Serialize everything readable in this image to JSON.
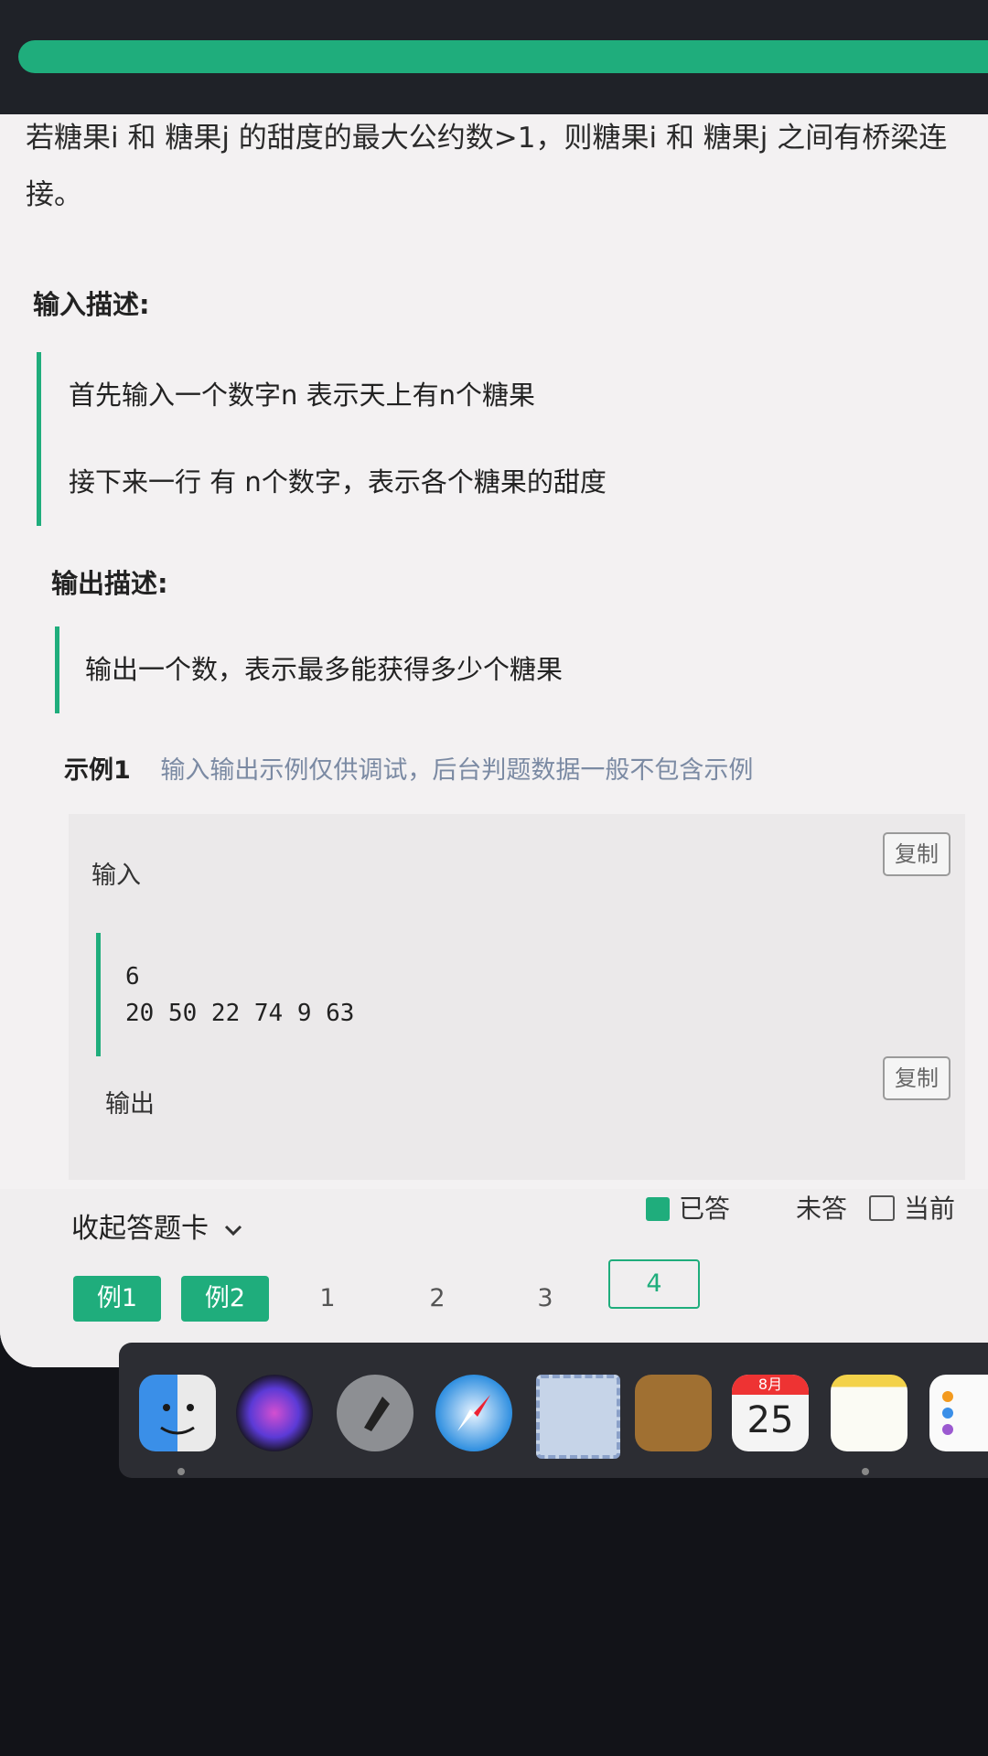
{
  "problem": {
    "description_tail": "若糖果i 和 糖果j 的甜度的最大公约数>1，则糖果i 和 糖果j 之间有桥梁连接。",
    "input_title": "输入描述:",
    "input_lines": [
      "首先输入一个数字n  表示天上有n个糖果",
      "接下来一行  有  n个数字，表示各个糖果的甜度"
    ],
    "output_title": "输出描述:",
    "output_lines": [
      "输出一个数，表示最多能获得多少个糖果"
    ]
  },
  "example": {
    "label": "示例1",
    "hint": "输入输出示例仅供调试，后台判题数据一般不包含示例",
    "input_label": "输入",
    "input_code": [
      "6",
      "20  50  22  74  9  63"
    ],
    "output_label": "输出",
    "copy_label": "复制"
  },
  "answer_card": {
    "collapse_label": "收起答题卡",
    "legend": {
      "answered": "已答",
      "unanswered": "未答",
      "current": "当前"
    },
    "questions": [
      "例1",
      "例2",
      "1",
      "2",
      "3",
      "4"
    ]
  },
  "dock": {
    "calendar_month": "8月",
    "calendar_day": "25",
    "icons": [
      "finder-icon",
      "siri-icon",
      "launchpad-icon",
      "safari-icon",
      "mail-icon",
      "contacts-icon",
      "calendar-icon",
      "notes-icon",
      "reminders-icon"
    ]
  },
  "colors": {
    "accent": "#1fad7c",
    "hint": "#7b8aa3"
  }
}
